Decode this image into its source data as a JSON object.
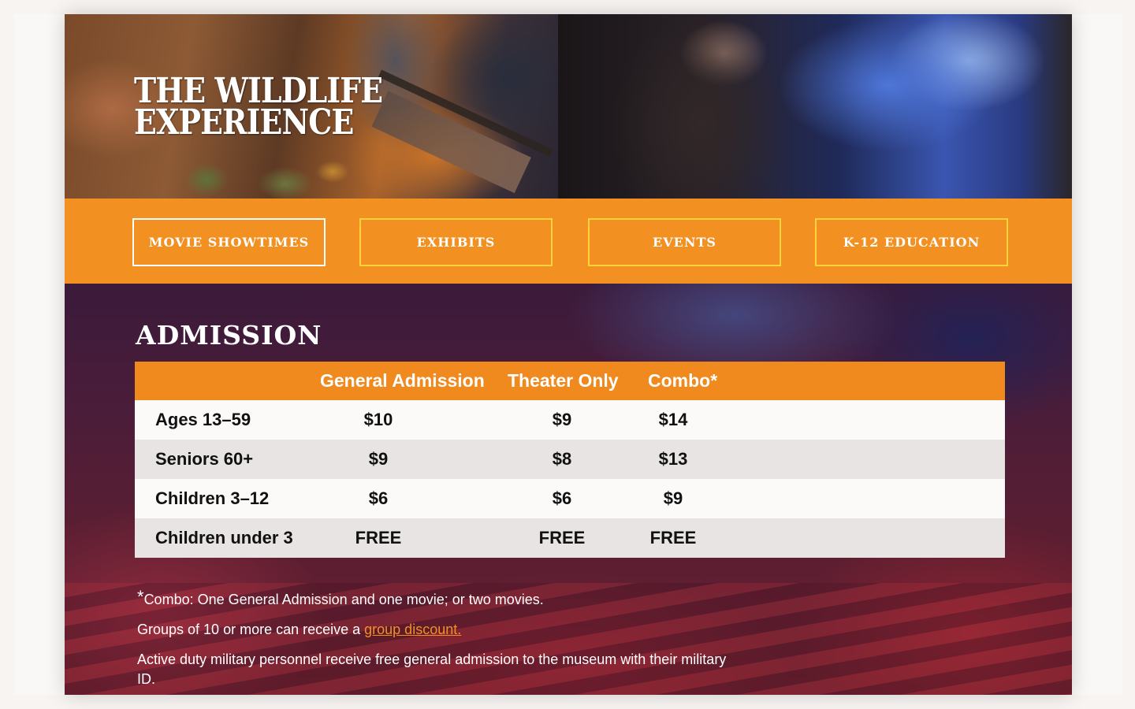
{
  "hero": {
    "title_line1": "THE WILDLIFE",
    "title_line2": "EXPERIENCE"
  },
  "nav": {
    "items": [
      {
        "label": "MOVIE SHOWTIMES",
        "active": true
      },
      {
        "label": "EXHIBITS",
        "active": false
      },
      {
        "label": "EVENTS",
        "active": false
      },
      {
        "label": "K-12 EDUCATION",
        "active": false
      }
    ]
  },
  "admission": {
    "title": "ADMISSION",
    "columns": [
      "",
      "General Admission",
      "Theater Only",
      "Combo*"
    ],
    "rows": [
      {
        "label": "Ages 13–59",
        "general": "$10",
        "theater": "$9",
        "combo": "$14"
      },
      {
        "label": "Seniors 60+",
        "general": "$9",
        "theater": "$8",
        "combo": "$13"
      },
      {
        "label": "Children 3–12",
        "general": "$6",
        "theater": "$6",
        "combo": "$9"
      },
      {
        "label": "Children under 3",
        "general": "FREE",
        "theater": "FREE",
        "combo": "FREE"
      }
    ],
    "notes": {
      "combo_star": "*",
      "combo_text": "Combo: One General Admission and one movie; or two movies.",
      "group_text": "Groups of 10 or more can receive a ",
      "group_link": "group discount.",
      "military_text": "Active duty military personnel receive free general admission to the museum with their military ID."
    }
  },
  "colors": {
    "nav_orange": "#f39022",
    "table_header_orange": "#f0891e",
    "nav_border_yellow": "#fbd33a",
    "link_orange": "#f39022"
  }
}
